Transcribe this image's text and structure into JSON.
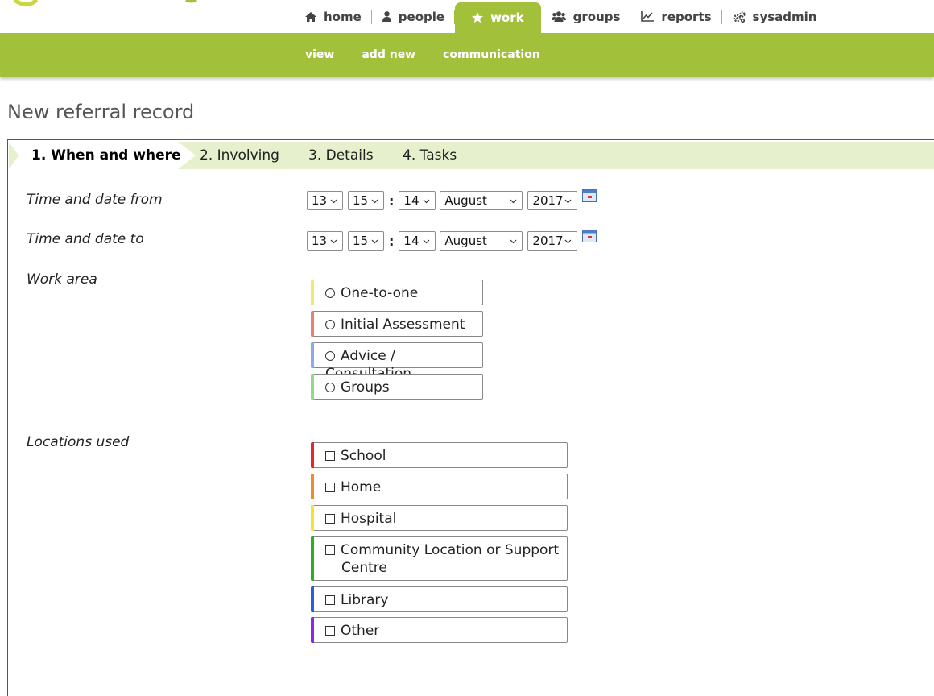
{
  "colors": {
    "brand_green": "#a2c03a",
    "step_bar": "#e6f0cc",
    "work_area": [
      "#f2ea6a",
      "#e8807a",
      "#8ea8f0",
      "#8edc8a"
    ],
    "locations": [
      "#e22a2a",
      "#f08a2a",
      "#f2e62a",
      "#2aae2a",
      "#2a5ee2",
      "#8a2ae2"
    ]
  },
  "topnav": [
    {
      "label": "home",
      "icon": "home-icon"
    },
    {
      "label": "people",
      "icon": "person-icon"
    },
    {
      "label": "work",
      "icon": "star-icon",
      "active": true
    },
    {
      "label": "groups",
      "icon": "users-icon"
    },
    {
      "label": "reports",
      "icon": "chart-icon"
    },
    {
      "label": "sysadmin",
      "icon": "gears-icon"
    }
  ],
  "subnav": [
    "view",
    "add new",
    "communication"
  ],
  "page_title": "New referral record",
  "steps": [
    "1. When and where",
    "2. Involving",
    "3. Details",
    "4. Tasks"
  ],
  "form": {
    "time_from": {
      "label": "Time and date from",
      "hour": "13",
      "minute": "15",
      "day": "14",
      "month": "August",
      "year": "2017"
    },
    "time_to": {
      "label": "Time and date to",
      "hour": "13",
      "minute": "15",
      "day": "14",
      "month": "August",
      "year": "2017"
    },
    "colon": ":",
    "work_area": {
      "label": "Work area",
      "options": [
        "One-to-one",
        "Initial Assessment",
        "Advice / Consultation",
        "Groups"
      ]
    },
    "locations": {
      "label": "Locations used",
      "options": [
        "School",
        "Home",
        "Hospital",
        "Community Location or Support",
        "Centre",
        "Library",
        "Other"
      ]
    }
  }
}
